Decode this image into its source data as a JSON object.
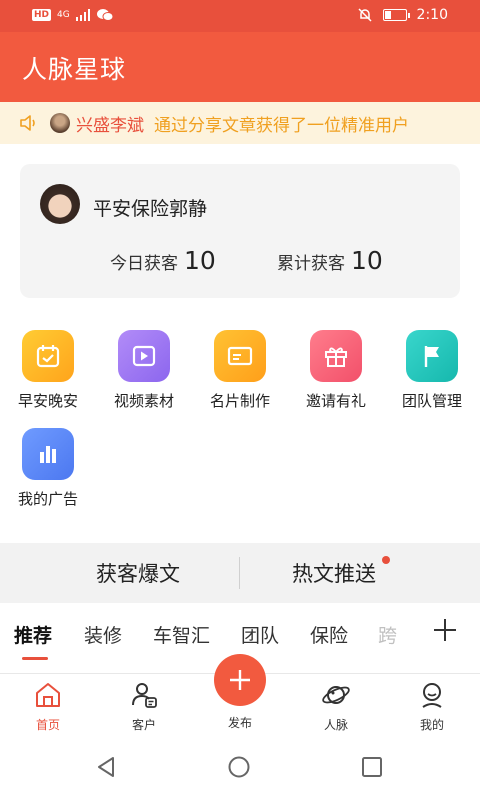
{
  "status_bar": {
    "network_badge": "HD",
    "signal": "4G",
    "time": "2:10"
  },
  "app": {
    "title": "人脉星球"
  },
  "notice": {
    "name": "兴盛李斌",
    "message": "通过分享文章获得了一位精准用户"
  },
  "profile": {
    "name": "平安保险郭静",
    "today_label": "今日获客",
    "today_value": "10",
    "total_label": "累计获客",
    "total_value": "10"
  },
  "tools": [
    {
      "label": "早安晚安",
      "icon": "calendar-icon",
      "color_from": "#ffcc33",
      "color_to": "#ffa41c"
    },
    {
      "label": "视频素材",
      "icon": "video-play-icon",
      "color_from": "#b28cf8",
      "color_to": "#8c66ee"
    },
    {
      "label": "名片制作",
      "icon": "business-card-icon",
      "color_from": "#ffc233",
      "color_to": "#ff9f1a"
    },
    {
      "label": "邀请有礼",
      "icon": "gift-icon",
      "color_from": "#ff7d8c",
      "color_to": "#f2506a"
    },
    {
      "label": "团队管理",
      "icon": "flag-icon",
      "color_from": "#39d6cc",
      "color_to": "#16b8ad"
    },
    {
      "label": "我的广告",
      "icon": "bar-chart-icon",
      "color_from": "#6f9bff",
      "color_to": "#4c78f0"
    }
  ],
  "article_tabs": {
    "left": "获客爆文",
    "right": "热文推送"
  },
  "categories": [
    "推荐",
    "装修",
    "车智汇",
    "团队",
    "保险",
    "跨"
  ],
  "bottom_nav": {
    "home": "首页",
    "customers": "客户",
    "publish": "发布",
    "network": "人脉",
    "mine": "我的"
  },
  "colors": {
    "brand": "#f25a3f",
    "notice_bg": "#fdf3dd",
    "notice_text": "#f0a020"
  }
}
